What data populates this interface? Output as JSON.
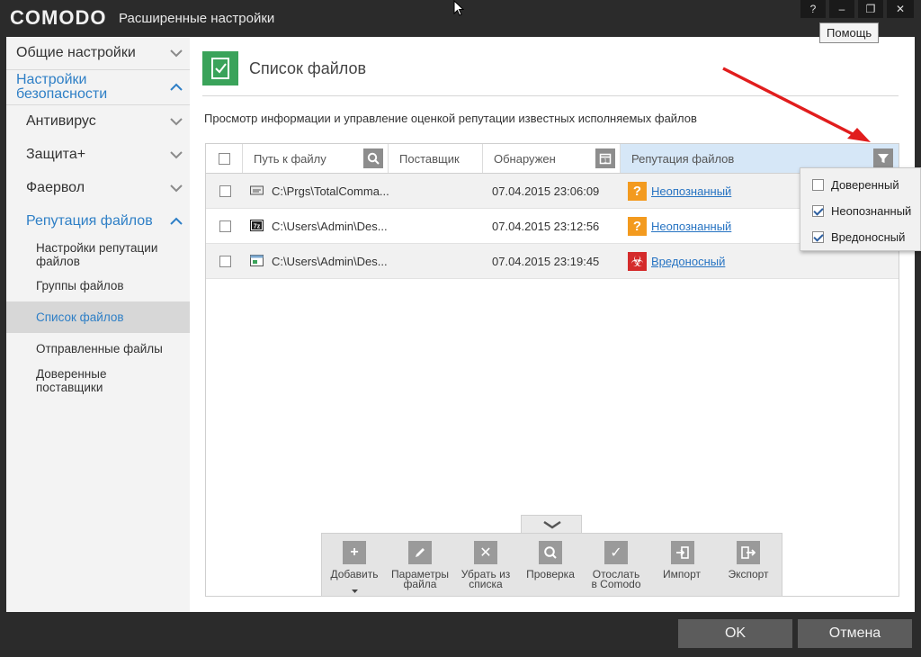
{
  "app": {
    "logo": "COMODO",
    "window_title": "Расширенные настройки",
    "window_buttons": {
      "help": "?",
      "minimize": "–",
      "restore": "❐",
      "close": "✕"
    },
    "tooltip": "Помощь"
  },
  "sidebar": {
    "items": [
      {
        "label": "Общие настройки"
      },
      {
        "label": "Настройки безопасности"
      },
      {
        "label": "Антивирус"
      },
      {
        "label": "Защита+"
      },
      {
        "label": "Фаервол"
      },
      {
        "label": "Репутация файлов"
      },
      {
        "label": "Настройки репутации файлов"
      },
      {
        "label": "Группы файлов"
      },
      {
        "label": "Список файлов"
      },
      {
        "label": "Отправленные файлы"
      },
      {
        "label": "Доверенные поставщики"
      }
    ],
    "active_item": "Список файлов"
  },
  "main": {
    "title": "Список файлов",
    "description": "Просмотр информации и управление оценкой репутации известных исполняемых файлов"
  },
  "table": {
    "columns": [
      "Путь к файлу",
      "Поставщик",
      "Обнаружен",
      "Репутация файлов"
    ],
    "rows": [
      {
        "path": "C:\\Prgs\\TotalComma...",
        "vendor": "",
        "detected": "07.04.2015 23:06:09",
        "reputation": "Неопознанный",
        "rep_icon": "?"
      },
      {
        "path": "C:\\Users\\Admin\\Des...",
        "vendor": "",
        "detected": "07.04.2015 23:12:56",
        "reputation": "Неопознанный",
        "rep_icon": "?"
      },
      {
        "path": "C:\\Users\\Admin\\Des...",
        "vendor": "",
        "detected": "07.04.2015 23:19:45",
        "reputation": "Вредоносный",
        "rep_icon": "☣"
      }
    ]
  },
  "filter": {
    "options": [
      {
        "label": "Доверенный",
        "checked": false
      },
      {
        "label": "Неопознанный",
        "checked": true
      },
      {
        "label": "Вредоносный",
        "checked": true
      }
    ]
  },
  "toolbar": {
    "buttons": [
      {
        "label": "Добавить"
      },
      {
        "label": "Параметры\nфайла"
      },
      {
        "label": "Убрать из\nсписка"
      },
      {
        "label": "Проверка"
      },
      {
        "label": "Отослать\nв Comodo"
      },
      {
        "label": "Импорт"
      },
      {
        "label": "Экспорт"
      }
    ]
  },
  "footer": {
    "ok": "OK",
    "cancel": "Отмена"
  },
  "colors": {
    "accent_blue": "#2e7fc6",
    "unknown_orange": "#f39a1e",
    "malicious_red": "#d42b2b",
    "header_green": "#3aa35a"
  }
}
